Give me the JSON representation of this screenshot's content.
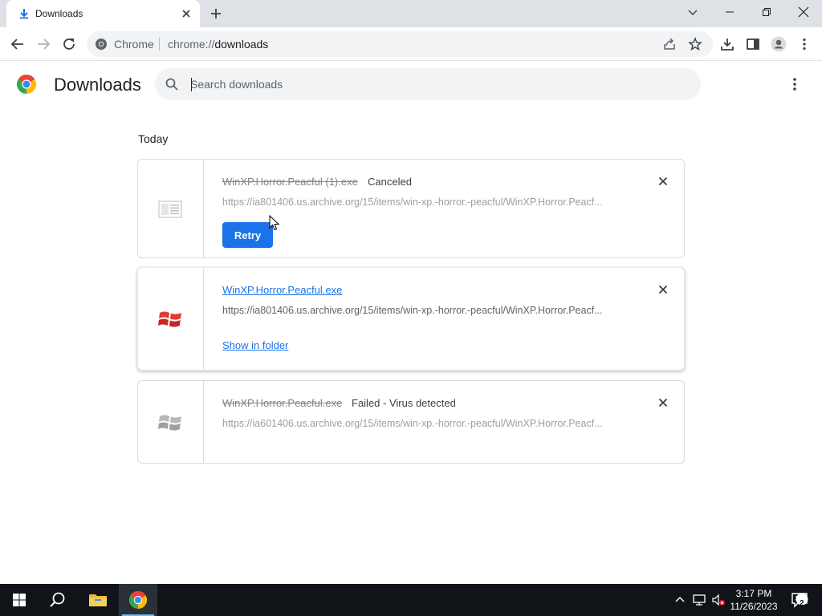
{
  "tab": {
    "title": "Downloads"
  },
  "omnibox": {
    "chip": "Chrome",
    "url_scheme": "chrome://",
    "url_host": "downloads"
  },
  "page": {
    "title": "Downloads",
    "search_placeholder": "Search downloads"
  },
  "section": {
    "label": "Today"
  },
  "downloads": [
    {
      "name": "WinXP.Horror.Peacful (1).exe",
      "status": "Canceled",
      "url": "https://ia801406.us.archive.org/15/items/win-xp.-horror.-peacful/WinXP.Horror.Peacf...",
      "action": "Retry"
    },
    {
      "name": "WinXP.Horror.Peacful.exe",
      "status": "",
      "url": "https://ia801406.us.archive.org/15/items/win-xp.-horror.-peacful/WinXP.Horror.Peacf...",
      "action": "Show in folder"
    },
    {
      "name": "WinXP.Horror.Peacful.exe",
      "status": "Failed - Virus detected",
      "url": "https://ia601406.us.archive.org/15/items/win-xp.-horror.-peacful/WinXP.Horror.Peacf...",
      "action": ""
    }
  ],
  "taskbar": {
    "time": "3:17 PM",
    "date": "11/26/2023",
    "notification_count": "2"
  },
  "colors": {
    "accent": "#1a73e8",
    "tab_strip": "#dee1e6",
    "taskbar": "#101418"
  }
}
